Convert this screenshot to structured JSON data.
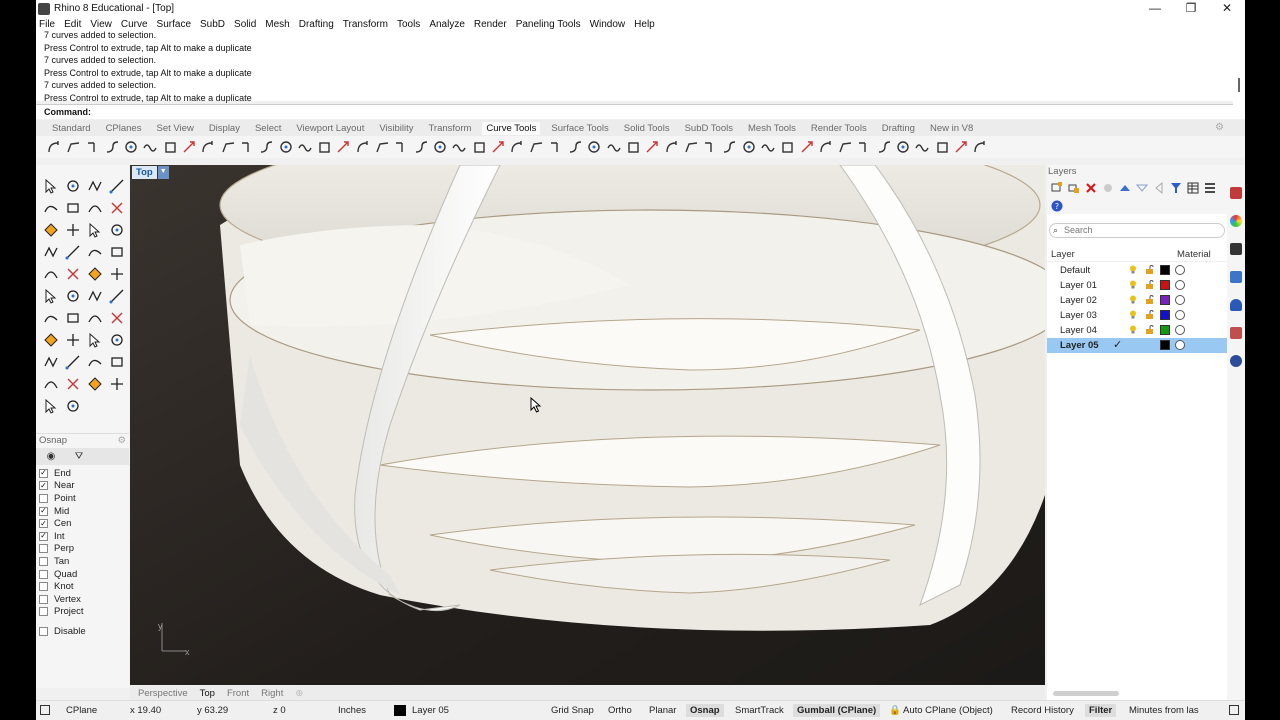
{
  "window": {
    "title": "Rhino 8 Educational - [Top]",
    "controls": [
      "—",
      "❐",
      "✕"
    ]
  },
  "menu": [
    "File",
    "Edit",
    "View",
    "Curve",
    "Surface",
    "SubD",
    "Solid",
    "Mesh",
    "Drafting",
    "Transform",
    "Tools",
    "Analyze",
    "Render",
    "Paneling Tools",
    "Window",
    "Help"
  ],
  "history": [
    "7 curves added to selection.",
    "Press Control to extrude, tap Alt to make a duplicate",
    "7 curves added to selection.",
    "Press Control to extrude, tap Alt to make a duplicate",
    "7 curves added to selection.",
    "Press Control to extrude, tap Alt to make a duplicate"
  ],
  "command_prompt": "Command:",
  "toolbar_tabs": [
    "Standard",
    "CPlanes",
    "Set View",
    "Display",
    "Select",
    "Viewport Layout",
    "Visibility",
    "Transform",
    "Curve Tools",
    "Surface Tools",
    "Solid Tools",
    "SubD Tools",
    "Mesh Tools",
    "Render Tools",
    "Drafting",
    "New in V8"
  ],
  "active_toolbar_tab": "Curve Tools",
  "viewport": {
    "name": "Top",
    "axis_x": "x",
    "axis_y": "y"
  },
  "viewport_tabs": [
    "Perspective",
    "Top",
    "Front",
    "Right"
  ],
  "active_viewport_tab": "Top",
  "osnap": {
    "title": "Osnap",
    "items": [
      {
        "label": "End",
        "checked": true
      },
      {
        "label": "Near",
        "checked": true
      },
      {
        "label": "Point",
        "checked": false
      },
      {
        "label": "Mid",
        "checked": true
      },
      {
        "label": "Cen",
        "checked": true
      },
      {
        "label": "Int",
        "checked": true
      },
      {
        "label": "Perp",
        "checked": false
      },
      {
        "label": "Tan",
        "checked": false
      },
      {
        "label": "Quad",
        "checked": false
      },
      {
        "label": "Knot",
        "checked": false
      },
      {
        "label": "Vertex",
        "checked": false
      },
      {
        "label": "Project",
        "checked": false
      }
    ],
    "disable_label": "Disable"
  },
  "layers": {
    "title": "Layers",
    "search_placeholder": "Search",
    "col_layer": "Layer",
    "col_material": "Material",
    "rows": [
      {
        "name": "Default",
        "color": "#000000",
        "current": false
      },
      {
        "name": "Layer 01",
        "color": "#cc1111",
        "current": false
      },
      {
        "name": "Layer 02",
        "color": "#7a22bb",
        "current": false
      },
      {
        "name": "Layer 03",
        "color": "#1111cc",
        "current": false
      },
      {
        "name": "Layer 04",
        "color": "#119911",
        "current": false
      },
      {
        "name": "Layer 05",
        "color": "#000000",
        "current": true
      }
    ]
  },
  "status": {
    "cplane": "CPlane",
    "x": "x 19.40",
    "y": "y 63.29",
    "z": "z 0",
    "units": "Inches",
    "layer": "Layer 05",
    "grid_snap": "Grid Snap",
    "ortho": "Ortho",
    "planar": "Planar",
    "osnap": "Osnap",
    "smarttrack": "SmartTrack",
    "gumball": "Gumball (CPlane)",
    "autocplane": "Auto CPlane (Object)",
    "record_history": "Record History",
    "filter": "Filter",
    "minutes": "Minutes from las"
  }
}
